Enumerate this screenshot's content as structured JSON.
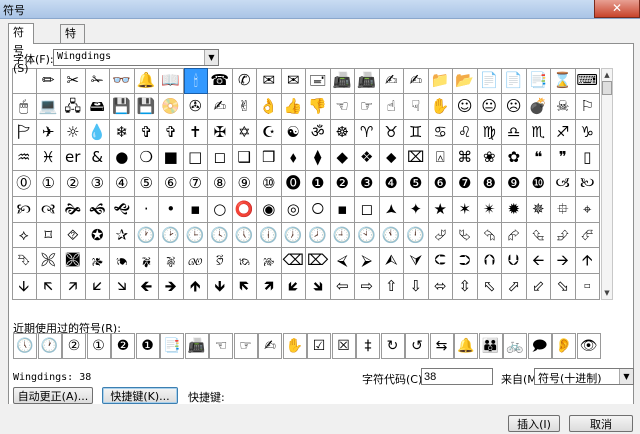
{
  "window": {
    "title": "符号",
    "close_glyph": "✕"
  },
  "tabs": [
    {
      "label": "符号(S)",
      "active": true
    },
    {
      "label": "特殊字符(P)",
      "active": false
    }
  ],
  "font": {
    "label": "字体(F):",
    "value": "Wingdings"
  },
  "grid": {
    "selected_index": 7,
    "rows": [
      [
        "",
        "✏",
        "✂",
        "✁",
        "👓",
        "🔔",
        "📖",
        "🕯",
        "☎",
        "✆",
        "✉",
        "✉",
        "🖃",
        "📠",
        "📠",
        "✍",
        "✍",
        "📁",
        "📂",
        "📄",
        "📄",
        "📑",
        "⌛",
        "⌨"
      ],
      [
        "🖱",
        "💻",
        "🖧",
        "🖴",
        "💾",
        "💾",
        "📀",
        "✇",
        "✍",
        "✌",
        "👌",
        "👍",
        "👎",
        "☜",
        "☞",
        "☝",
        "☟",
        "✋",
        "☺",
        "😐",
        "☹",
        "💣",
        "☠",
        "⚐"
      ],
      [
        "🏱",
        "✈",
        "☼",
        "💧",
        "❄",
        "✞",
        "✞",
        "✝",
        "✠",
        "✡",
        "☪",
        "☯",
        "ॐ",
        "☸",
        "♈",
        "♉",
        "♊",
        "♋",
        "♌",
        "♍",
        "♎",
        "♏",
        "♐",
        "♑"
      ],
      [
        "♒",
        "♓",
        "er",
        "&",
        "●",
        "❍",
        "■",
        "□",
        "◻",
        "❑",
        "❒",
        "⬧",
        "⧫",
        "◆",
        "❖",
        "⬥",
        "⌧",
        "⍓",
        "⌘",
        "❀",
        "✿",
        "❝",
        "❞",
        "▯"
      ],
      [
        "⓪",
        "①",
        "②",
        "③",
        "④",
        "⑤",
        "⑥",
        "⑦",
        "⑧",
        "⑨",
        "⑩",
        "⓿",
        "❶",
        "❷",
        "❸",
        "❹",
        "❺",
        "❻",
        "❼",
        "❽",
        "❾",
        "❿",
        "🙢",
        "🙠"
      ],
      [
        "🙡",
        "🙣",
        "🙞",
        "🙜",
        "🙝",
        "·",
        "•",
        "▪",
        "○",
        "⭕",
        "◉",
        "◎",
        "🞅",
        "▪",
        "◻",
        "🟂",
        "✦",
        "★",
        "✶",
        "✴",
        "✹",
        "✵",
        "⯐",
        "⌖"
      ],
      [
        "⟡",
        "⌑",
        "⯑",
        "✪",
        "✰",
        "🕐",
        "🕑",
        "🕒",
        "🕓",
        "🕔",
        "🕕",
        "🕖",
        "🕗",
        "🕘",
        "🕙",
        "🕚",
        "🕛",
        "⮰",
        "⮱",
        "⮲",
        "⮳",
        "⮴",
        "⮵",
        "⮶"
      ],
      [
        "⮷",
        "🙪",
        "🙫",
        "🙕",
        "🙔",
        "🙗",
        "🙖",
        "🙐",
        "🙑",
        "🙒",
        "🙓",
        "⌫",
        "⌦",
        "⮘",
        "⮚",
        "⮙",
        "⮛",
        "⮈",
        "⮊",
        "⮉",
        "⮋",
        "🡨",
        "🡪",
        "🡩"
      ],
      [
        "🡫",
        "🡬",
        "🡭",
        "🡯",
        "🡮",
        "🡸",
        "🡺",
        "🡹",
        "🡻",
        "🡼",
        "🡽",
        "🡿",
        "🡾",
        "⇦",
        "⇨",
        "⇧",
        "⇩",
        "⬄",
        "⇳",
        "⬁",
        "⬀",
        "⬃",
        "⬂",
        "🢬"
      ]
    ]
  },
  "recent": {
    "label": "近期使用过的符号(R):",
    "items": [
      "🕔",
      "🕐",
      "②",
      "①",
      "❷",
      "❶",
      "📑",
      "📠",
      "☜",
      "☞",
      "✍",
      "✋",
      "☑",
      "☒",
      "‡",
      "↻",
      "↺",
      "⇆",
      "🔔",
      "👪",
      "🚲",
      "🗩",
      "👂",
      "👁"
    ]
  },
  "status": {
    "font_code": "Wingdings: 38"
  },
  "char_code": {
    "label": "字符代码(C):",
    "value": "38"
  },
  "from": {
    "label": "来自(M):",
    "value": "符号(十进制)"
  },
  "buttons": {
    "autocorrect": "自动更正(A)...",
    "shortcut_key": "快捷键(K)...",
    "shortcut_label": "快捷键:",
    "insert": "插入(I)",
    "cancel": "取消"
  }
}
